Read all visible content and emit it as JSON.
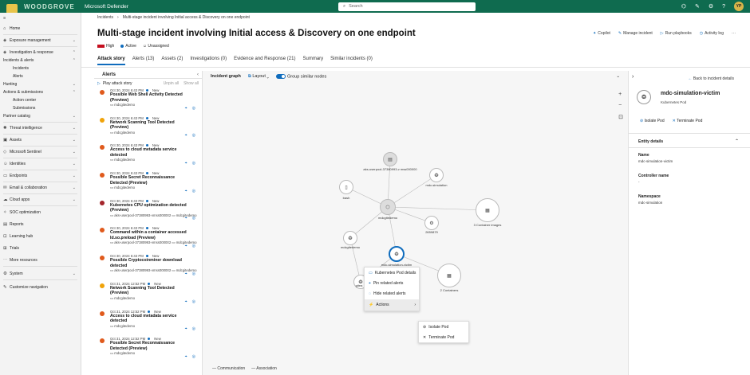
{
  "brand": "WOODGROVE",
  "app_name": "Microsoft Defender",
  "search_placeholder": "Search",
  "user_initials": "YP",
  "nav": {
    "home": "Home",
    "exposure": "Exposure management",
    "investigation": "Investigation & response",
    "incidents_alerts": "Incidents & alerts",
    "incidents": "Incidents",
    "alerts": "Alerts",
    "hunting": "Hunting",
    "actions_submissions": "Actions & submissions",
    "action_center": "Action center",
    "submissions": "Submissions",
    "partner_catalog": "Partner catalog",
    "threat_intel": "Threat intelligence",
    "assets": "Assets",
    "sentinel": "Microsoft Sentinel",
    "identities": "Identities",
    "endpoints": "Endpoints",
    "email": "Email & collaboration",
    "cloud_apps": "Cloud apps",
    "soc": "SOC optimization",
    "reports": "Reports",
    "learning": "Learning hub",
    "trials": "Trials",
    "more": "More resources",
    "system": "System",
    "customize": "Customize navigation"
  },
  "breadcrumb": {
    "root": "Incidents",
    "current": "Multi-stage incident involving Initial access & Discovery on one endpoint"
  },
  "title": "Multi-stage incident involving Initial access & Discovery on one endpoint",
  "title_actions": {
    "copilot": "Copilot",
    "manage": "Manage incident",
    "playbooks": "Run playbooks",
    "activity": "Activity log",
    "more": "···"
  },
  "meta": {
    "severity": "High",
    "status": "Active",
    "assigned": "Unassigned",
    "severity_color": "#c50f1f",
    "status_color": "#0f6cbd"
  },
  "tabs": [
    "Attack story",
    "Alerts (13)",
    "Assets (2)",
    "Investigations (0)",
    "Evidence and Response (21)",
    "Summary",
    "Similar incidents (0)"
  ],
  "alerts_panel": {
    "header": "Alerts",
    "play": "Play attack story",
    "unpin": "Unpin all",
    "show": "Show all"
  },
  "alerts": [
    {
      "date": "Oct 30, 2024 6:43 PM",
      "status": "New",
      "name": "Possible Web Shell Activity Detected (Preview)",
      "entities": [
        "mdcgitedemo"
      ],
      "color": "#e05a1c"
    },
    {
      "date": "Oct 30, 2024 6:43 PM",
      "status": "New",
      "name": "Network Scanning Tool Detected (Preview)",
      "entities": [
        "mdcgitedemo"
      ],
      "color": "#f0a30a"
    },
    {
      "date": "Oct 30, 2024 6:43 PM",
      "status": "New",
      "name": "Access to cloud metadata service detected",
      "entities": [
        "mdcgitedemo"
      ],
      "color": "#e05a1c"
    },
    {
      "date": "Oct 30, 2024 6:43 PM",
      "status": "New",
      "name": "Possible Secret Reconnaissance Detected (Preview)",
      "entities": [
        "mdcgitedemo"
      ],
      "color": "#e05a1c"
    },
    {
      "date": "Oct 30, 2024 6:43 PM",
      "status": "New",
      "name": "Kubernetes CPU optimization detected (Preview)",
      "entities": [
        "aks-userpool-37380993-vmss000002",
        "mdcgitedemo"
      ],
      "color": "#a4262c"
    },
    {
      "date": "Oct 30, 2024 6:43 PM",
      "status": "New",
      "name": "Command within a container accessed ld.so.preload (Preview)",
      "entities": [
        "aks-userpool-37380993-vmss000002",
        "mdcgitedemo"
      ],
      "color": "#e05a1c"
    },
    {
      "date": "Oct 30, 2024 6:43 PM",
      "status": "New",
      "name": "Possible Cryptocoinminer download detected",
      "entities": [
        "aks-userpool-37380993-vmss000002",
        "mdcgitedemo"
      ],
      "color": "#e05a1c"
    },
    {
      "date": "Oct 31, 2024 12:52 PM",
      "status": "New",
      "name": "Network Scanning Tool Detected (Preview)",
      "entities": [
        "mdcgitedemo"
      ],
      "color": "#f0a30a"
    },
    {
      "date": "Oct 31, 2024 12:52 PM",
      "status": "New",
      "name": "Access to cloud metadata service detected",
      "entities": [
        "mdcgitedemo"
      ],
      "color": "#e05a1c"
    },
    {
      "date": "Oct 31, 2024 12:52 PM",
      "status": "New",
      "name": "Possible Secret Reconnaissance Detected (Preview)",
      "entities": [
        "mdcgitedemo"
      ],
      "color": "#e05a1c"
    }
  ],
  "graph": {
    "header": "Incident graph",
    "layout": "Layout",
    "group": "Group similar nodes",
    "nodes": {
      "aks": "aks-userpool-37380993-v mss000000",
      "mdc_sim": "mdc-simulation",
      "bash": "bash",
      "mdcgitedemo": "mdcgitedemo",
      "containers3": "3 Container images",
      "proc": "2659879",
      "mdcgitedemo2": "mdcgitedemo",
      "victim": "mdc-simulation-victim",
      "containers2": "2 Containers",
      "gitea": "gitea"
    },
    "legend_comm": "Communication",
    "legend_assoc": "Association"
  },
  "context_menu": [
    "Kubernetes Pod details",
    "Pin related alerts",
    "Hide related alerts",
    "Actions"
  ],
  "submenu": [
    "Isolate Pod",
    "Terminate Pod"
  ],
  "detail": {
    "back": "Back to incident details",
    "name": "mdc-simulation-victim",
    "type": "Kubernetes Pod",
    "isolate": "Isolate Pod",
    "terminate": "Terminate Pod",
    "section": "Entity details",
    "fields": [
      {
        "label": "Name",
        "value": "mdc-simulation-victim"
      },
      {
        "label": "Controller name",
        "value": "-"
      },
      {
        "label": "Namespace",
        "value": "mdc-simulation"
      }
    ]
  }
}
